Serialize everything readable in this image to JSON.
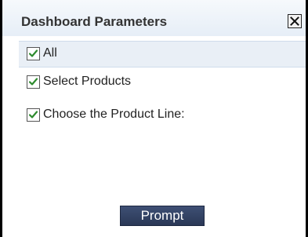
{
  "dialog": {
    "title": "Dashboard Parameters",
    "close_icon": "close-icon"
  },
  "options": [
    {
      "label": "All",
      "checked": true
    },
    {
      "label": "Select Products",
      "checked": true
    },
    {
      "label": "Choose the Product Line:",
      "checked": true
    }
  ],
  "actions": {
    "prompt_label": "Prompt"
  },
  "colors": {
    "accent_check": "#2e8b2e",
    "button_bg": "#34446a",
    "header_bg": "#eaf0f7"
  }
}
